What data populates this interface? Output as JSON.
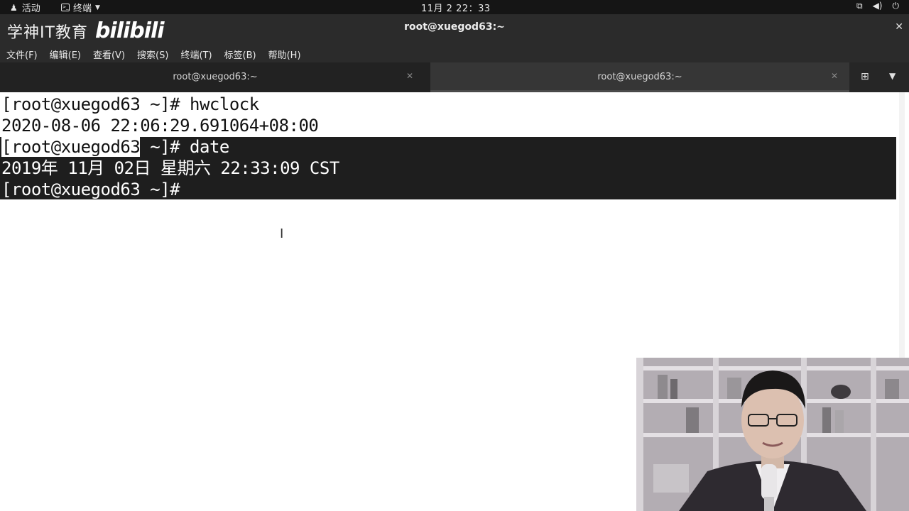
{
  "topbar": {
    "activities": "活动",
    "app_menu": "终端",
    "clock": "11月 2 22：33"
  },
  "window": {
    "title": "root@xuegod63:~",
    "watermark_text": "学神IT教育",
    "watermark_logo": "bilibili"
  },
  "menubar": {
    "items": [
      "文件(F)",
      "编辑(E)",
      "查看(V)",
      "搜索(S)",
      "终端(T)",
      "标签(B)",
      "帮助(H)"
    ]
  },
  "tabs": [
    {
      "label": "root@xuegod63:~",
      "active": false
    },
    {
      "label": "root@xuegod63:~",
      "active": true
    }
  ],
  "terminal": {
    "line1": "[root@xuegod63 ~]# hwclock",
    "line2": "2020-08-06 22:06:29.691064+08:00",
    "line3_highlight": "[root@xuegod63",
    "line3_rest": " ~]# date",
    "line4": "2019年 11月 02日 星期六 22:33:09 CST",
    "line5": "[root@xuegod63 ~]#"
  },
  "colors": {
    "titlebar_bg": "#2b2b2b",
    "topbar_bg": "#151515",
    "selection_bg": "#1e1e1e",
    "terminal_bg": "#ffffff"
  }
}
